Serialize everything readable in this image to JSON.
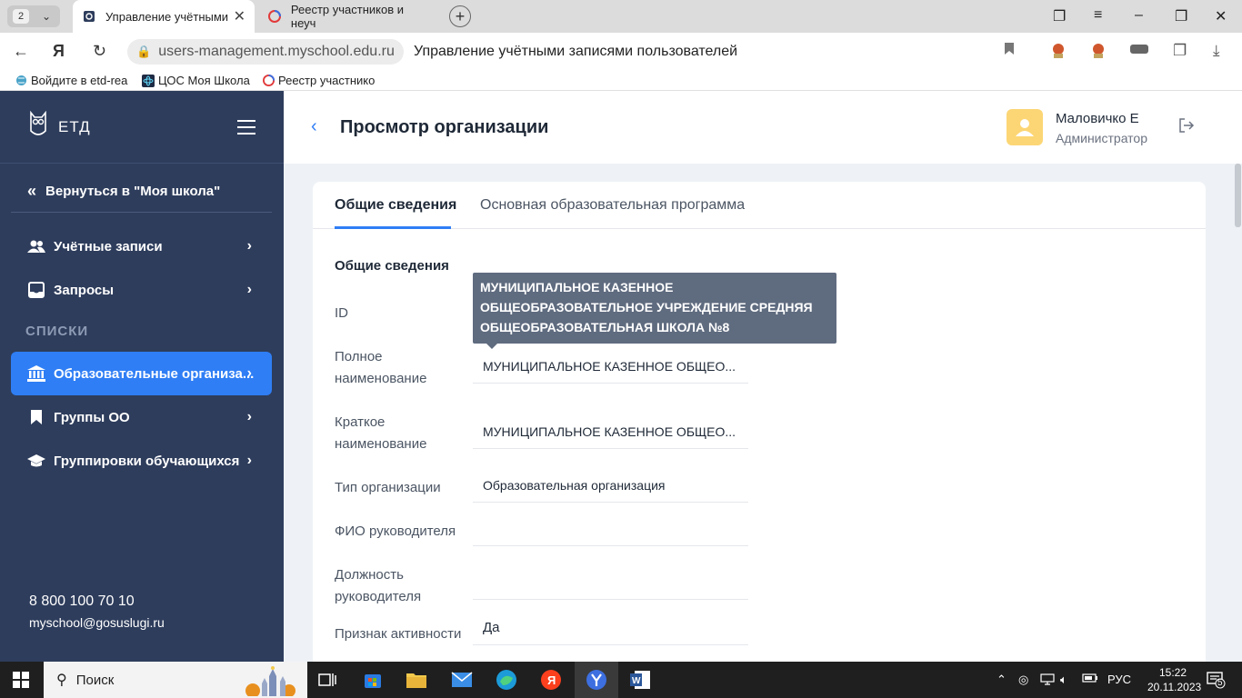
{
  "browser": {
    "tab_count": "2",
    "tabs": [
      {
        "title": "Управление учётными"
      },
      {
        "title": "Реестр участников и неуч"
      }
    ],
    "url": "users-management.myschool.edu.ru",
    "page_title": "Управление учётными записями пользователей",
    "bookmarks": [
      {
        "label": "Войдите в etd-rea"
      },
      {
        "label": "ЦОС Моя Школа"
      },
      {
        "label": "Реестр участнико"
      }
    ]
  },
  "sidebar": {
    "logo_text": "ЕТД",
    "back_label": "Вернуться в \"Моя школа\"",
    "items_top": [
      {
        "label": "Учётные записи",
        "icon": "users-icon"
      },
      {
        "label": "Запросы",
        "icon": "inbox-icon"
      }
    ],
    "section_label": "СПИСКИ",
    "items_lists": [
      {
        "label": "Образовательные организа...",
        "icon": "institution-icon",
        "active": true
      },
      {
        "label": "Группы ОО",
        "icon": "bookmark-icon",
        "active": false
      },
      {
        "label": "Группировки обучающихся",
        "icon": "graduation-cap-icon",
        "active": false
      }
    ],
    "phone": "8 800 100 70 10",
    "email": "myschool@gosuslugi.ru"
  },
  "header": {
    "title": "Просмотр организации",
    "user_name": "Маловичко Е",
    "user_role": "Администратор"
  },
  "content": {
    "tabs": [
      {
        "label": "Общие сведения",
        "active": true
      },
      {
        "label": "Основная образовательная программа",
        "active": false
      }
    ],
    "section_title": "Общие сведения",
    "fields": [
      {
        "label": "ID",
        "value": ""
      },
      {
        "label": "Полное наименование",
        "value": "МУНИЦИПАЛЬНОЕ КАЗЕННОЕ ОБЩЕО..."
      },
      {
        "label": "Краткое наименование",
        "value": "МУНИЦИПАЛЬНОЕ КАЗЕННОЕ ОБЩЕО..."
      },
      {
        "label": "Тип организации",
        "value": "Образовательная организация"
      },
      {
        "label": "ФИО руководителя",
        "value": ""
      },
      {
        "label": "Должность руководителя",
        "value": ""
      },
      {
        "label": "Признак активности",
        "value": "Да"
      }
    ],
    "tooltip": "МУНИЦИПАЛЬНОЕ КАЗЕННОЕ ОБЩЕОБРАЗОВАТЕЛЬНОЕ УЧРЕЖДЕНИЕ СРЕДНЯЯ ОБЩЕОБРАЗОВАТЕЛЬНАЯ ШКОЛА №8"
  },
  "taskbar": {
    "search_label": "Поиск",
    "language": "РУС",
    "time": "15:22",
    "date": "20.11.2023",
    "notifications": "5"
  },
  "colors": {
    "sidebar_bg": "#2e3d5c",
    "accent": "#2f7ef5",
    "tooltip_bg": "#5f6b7f",
    "avatar_bg": "#fcd675"
  }
}
